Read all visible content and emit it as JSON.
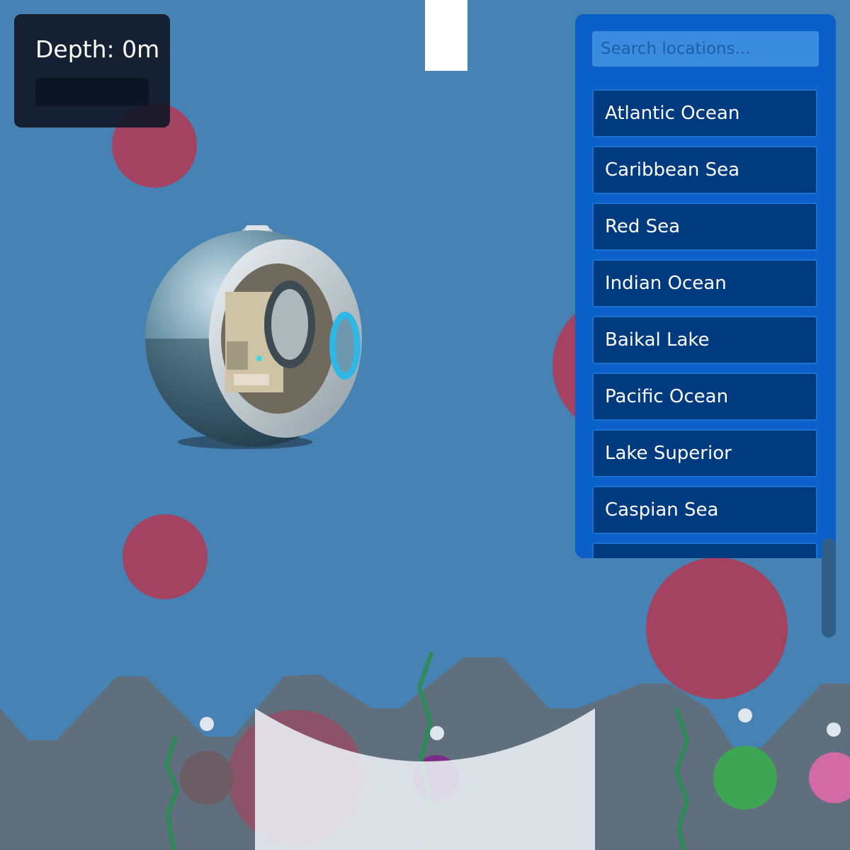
{
  "hud": {
    "depth_text": "Depth: 0m",
    "depth_progress": 0
  },
  "locations": {
    "search_placeholder": "Search locations...",
    "items": [
      "Atlantic Ocean",
      "Caribbean Sea",
      "Red Sea",
      "Indian Ocean",
      "Baikal Lake",
      "Pacific Ocean",
      "Lake Superior",
      "Caspian Sea"
    ]
  },
  "colors": {
    "water": "#4682b4",
    "seabed": "#5f6f7d",
    "panel": "#0a60c8",
    "location_button": "#003b80",
    "hud": "#111827",
    "hazard_orb": "#b03a55",
    "sediment": "#dde3ea",
    "seaweed": "#2e8b57",
    "bubble": "#dfe6ee"
  },
  "icons": {
    "player": "submersible-pod-icon"
  }
}
